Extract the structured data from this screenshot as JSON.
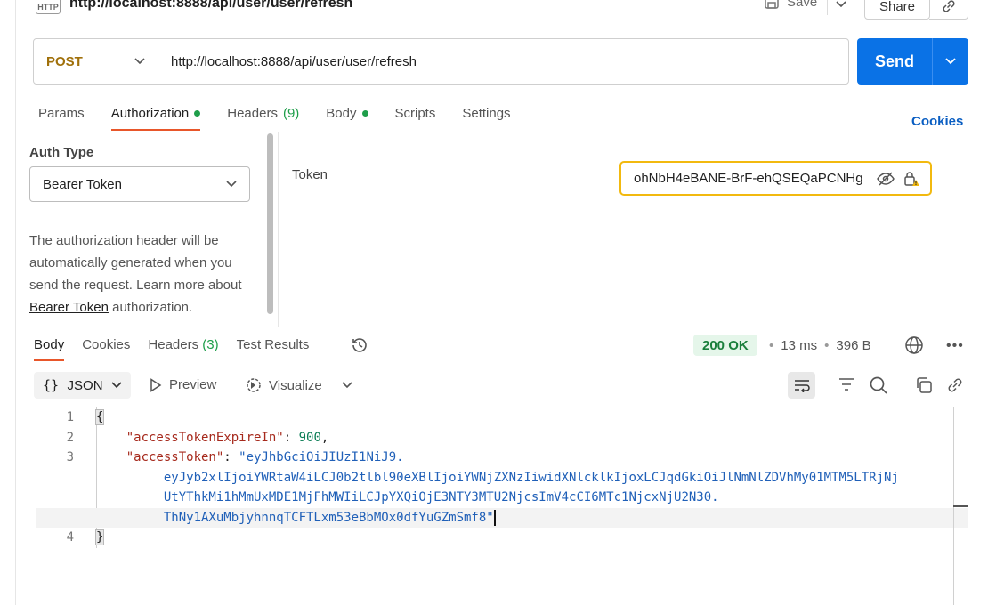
{
  "header": {
    "http_badge": "HTTP",
    "title": "http://localhost:8888/api/user/user/refresh",
    "save_label": "Save",
    "share_label": "Share"
  },
  "request": {
    "method": "POST",
    "url": "http://localhost:8888/api/user/user/refresh",
    "send_label": "Send",
    "tabs": [
      {
        "label": "Params"
      },
      {
        "label": "Authorization",
        "dot": true
      },
      {
        "label": "Headers",
        "count": "(9)"
      },
      {
        "label": "Body",
        "dot": true
      },
      {
        "label": "Scripts"
      },
      {
        "label": "Settings"
      }
    ],
    "active_tab": "Authorization",
    "cookies_label": "Cookies"
  },
  "auth": {
    "type_label": "Auth Type",
    "type_value": "Bearer Token",
    "description_pre": "The authorization header will be automatically generated when you send the request. Learn more about ",
    "description_link": "Bearer Token",
    "description_post": " authorization.",
    "token_label": "Token",
    "token_value": "ohNbH4eBANE-BrF-ehQSEQaPCNHg"
  },
  "response": {
    "tabs": [
      {
        "label": "Body"
      },
      {
        "label": "Cookies"
      },
      {
        "label": "Headers",
        "count": "(3)"
      },
      {
        "label": "Test Results"
      }
    ],
    "active_tab": "Body",
    "status": "200 OK",
    "time": "13 ms",
    "size": "396 B",
    "format_label": "JSON",
    "preview_label": "Preview",
    "visualize_label": "Visualize",
    "lines": [
      {
        "n": "1",
        "open": "{"
      },
      {
        "n": "2",
        "key": "\"accessTokenExpireIn\"",
        "sep": ": ",
        "num": "900",
        "tail": ","
      },
      {
        "n": "3",
        "key": "\"accessToken\"",
        "sep": ": ",
        "str": "\"eyJhbGciOiJIUzI1NiJ9."
      },
      {
        "n": "",
        "str": "eyJyb2xlIjoiYWRtaW4iLCJ0b2tlbl90eXBlIjoiYWNjZXNzIiwidXNlcklkIjoxLCJqdGkiOiJlNmNlZDVhMy01MTM5LTRjNj"
      },
      {
        "n": "",
        "str": "UtYThkMi1hMmUxMDE1MjFhMWIiLCJpYXQiOjE3NTY3MTU2NjcsImV4cCI6MTc1NjcxNjU2N30."
      },
      {
        "n": "",
        "str": "ThNy1AXuMbjyhnnqTCFTLxm53eBbMOx0dfYuGZmSmf8\""
      },
      {
        "n": "4",
        "open": "}"
      }
    ]
  },
  "colors": {
    "send": "#0a72e6",
    "active_tab_underline": "#e8562a",
    "status_ok": "#1a7f3c",
    "token_border": "#f2b90f"
  }
}
